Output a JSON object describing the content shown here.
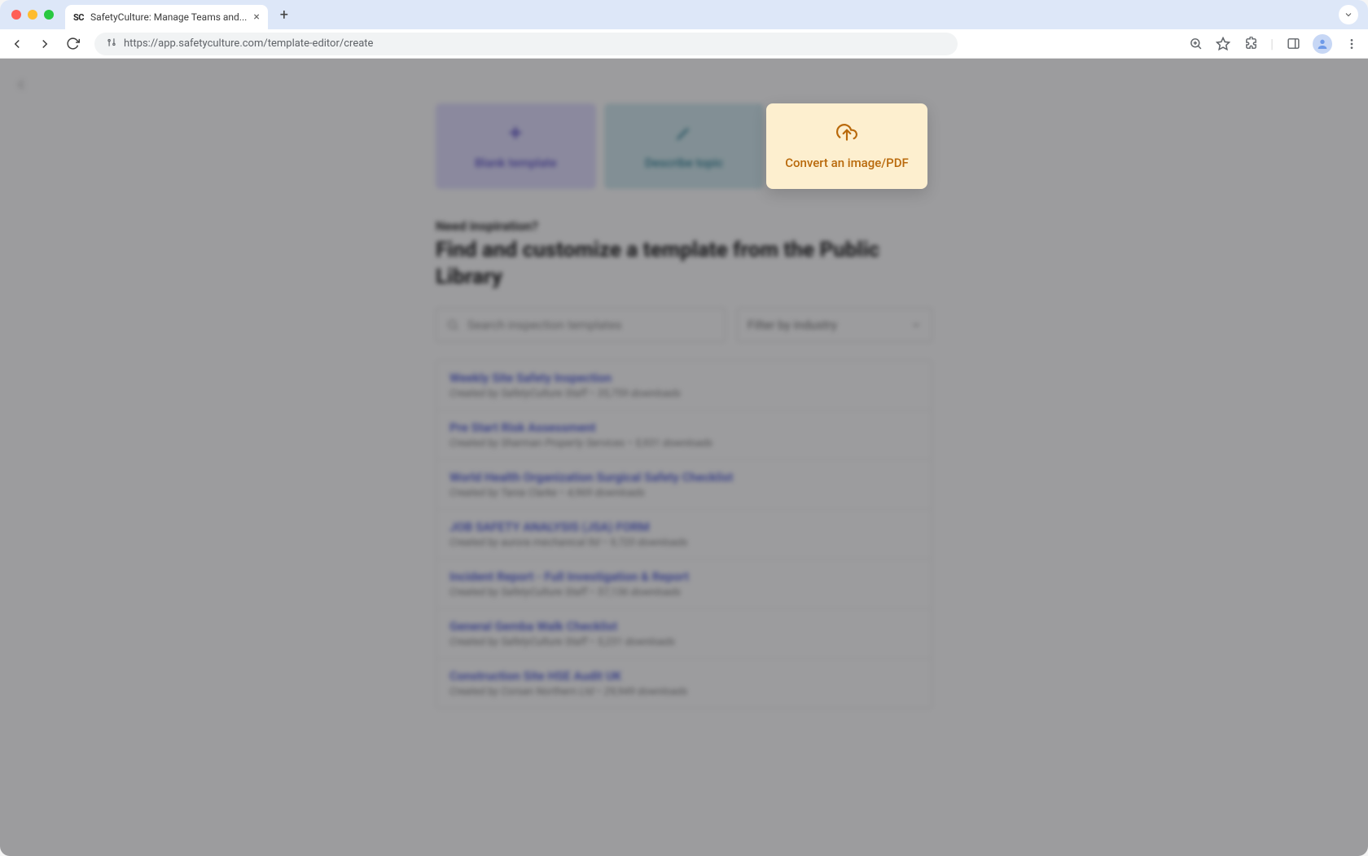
{
  "browser": {
    "tab_title": "SafetyCulture: Manage Teams and...",
    "url": "https://app.safetyculture.com/template-editor/create"
  },
  "create_options": {
    "blank": {
      "label": "Blank template"
    },
    "describe": {
      "label": "Describe topic"
    },
    "convert": {
      "label": "Convert an image/PDF"
    }
  },
  "library": {
    "eyebrow": "Need inspiration?",
    "title": "Find and customize a template from the Public Library",
    "search_placeholder": "Search inspection templates",
    "filter_label": "Filter by industry"
  },
  "templates": [
    {
      "title": "Weekly Site Safety Inspection",
      "author": "SafetyCulture Staff",
      "downloads": "35,759 downloads"
    },
    {
      "title": "Pre Start Risk Assessment",
      "author": "Sharman Property Services",
      "downloads": "5,931 downloads"
    },
    {
      "title": "World Health Organization Surgical Safety Checklist",
      "author": "Tania Clarke",
      "downloads": "4,969 downloads"
    },
    {
      "title": "JOB SAFETY ANALYSIS (JSA) FORM",
      "author": "aurora mechanical ltd",
      "downloads": "9,720 downloads"
    },
    {
      "title": "Incident Report - Full Investigation & Report",
      "author": "SafetyCulture Staff",
      "downloads": "57,136 downloads"
    },
    {
      "title": "General Gemba Walk Checklist",
      "author": "SafetyCulture Staff",
      "downloads": "5,231 downloads"
    },
    {
      "title": "Construction Site HSE Audit UK",
      "author": "Corsan Northern Ltd",
      "downloads": "29,949 downloads"
    }
  ],
  "meta_prefix": "Created by ",
  "meta_sep": "•"
}
